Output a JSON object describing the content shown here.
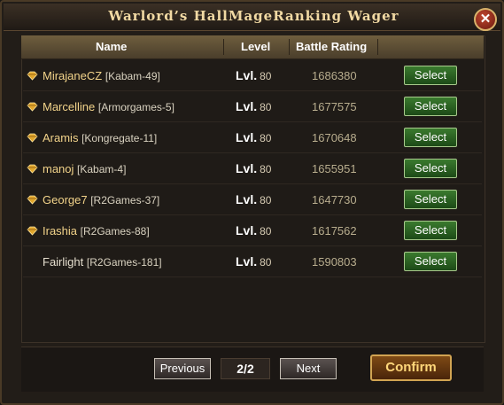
{
  "window": {
    "title": "Warlord’s HallMageRanking Wager",
    "close_label": "✕"
  },
  "table": {
    "headers": {
      "name": "Name",
      "level": "Level",
      "rating": "Battle Rating"
    },
    "level_prefix": "Lvl.",
    "select_label": "Select",
    "rows": [
      {
        "name": "MirajaneCZ",
        "server": "[Kabam-49]",
        "level": "80",
        "rating": "1686380",
        "gem": true
      },
      {
        "name": "Marcelline",
        "server": "[Armorgames-5]",
        "level": "80",
        "rating": "1677575",
        "gem": true
      },
      {
        "name": "Aramis",
        "server": "[Kongregate-11]",
        "level": "80",
        "rating": "1670648",
        "gem": true
      },
      {
        "name": "manoj",
        "server": "[Kabam-4]",
        "level": "80",
        "rating": "1655951",
        "gem": true
      },
      {
        "name": "George7",
        "server": "[R2Games-37]",
        "level": "80",
        "rating": "1647730",
        "gem": true
      },
      {
        "name": "Irashia",
        "server": "[R2Games-88]",
        "level": "80",
        "rating": "1617562",
        "gem": true
      },
      {
        "name": "Fairlight",
        "server": "[R2Games-181]",
        "level": "80",
        "rating": "1590803",
        "gem": false
      }
    ]
  },
  "pagination": {
    "previous": "Previous",
    "page": "2/2",
    "next": "Next"
  },
  "confirm_label": "Confirm",
  "colors": {
    "accent": "#f2d38a",
    "select_green": "#2f6a26",
    "confirm_bg": "#6a3a10"
  }
}
